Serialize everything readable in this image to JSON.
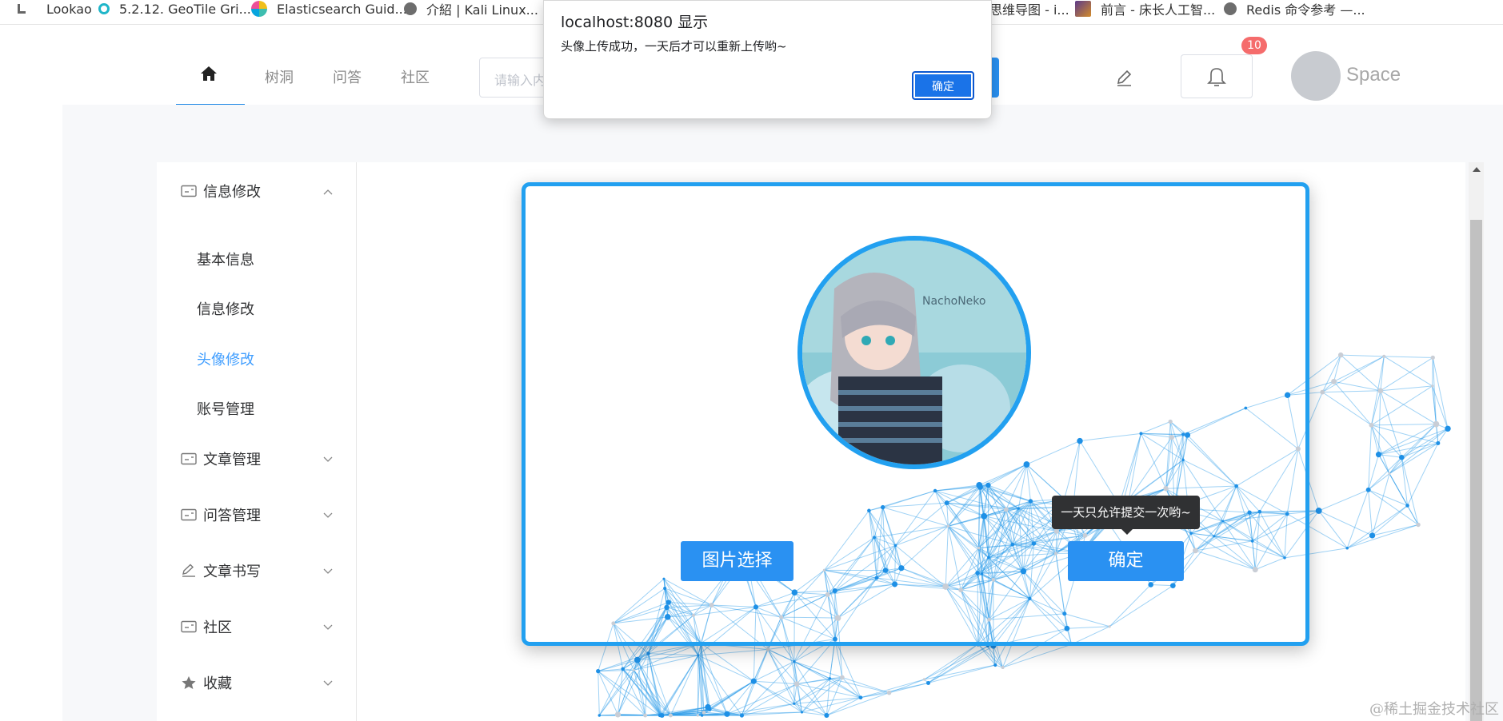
{
  "bookmarks": [
    {
      "label": "Lookao",
      "icon": "bookmark-l-icon"
    },
    {
      "label": "5.2.12. GeoTile Gri...",
      "icon": "geotile-icon"
    },
    {
      "label": "Elasticsearch Guid...",
      "icon": "elastic-icon"
    },
    {
      "label": "介紹 | Kali Linux...",
      "icon": "globe-icon"
    },
    {
      "label": "思维导图 - i...",
      "icon": "mindmap-icon"
    },
    {
      "label": "前言 - 床长人工智...",
      "icon": "ai-icon"
    },
    {
      "label": "Redis 命令参考 —...",
      "icon": "globe-icon"
    }
  ],
  "header": {
    "nav": [
      "树洞",
      "问答",
      "社区"
    ],
    "search_placeholder": "请输入内",
    "notification_count": "10",
    "username": "Space"
  },
  "sidebar": {
    "menus": [
      {
        "label": "信息修改",
        "icon": "card-icon",
        "expanded": true
      },
      {
        "label": "文章管理",
        "icon": "card-icon"
      },
      {
        "label": "问答管理",
        "icon": "card-icon"
      },
      {
        "label": "文章书写",
        "icon": "pen-icon"
      },
      {
        "label": "社区",
        "icon": "card-icon"
      },
      {
        "label": "收藏",
        "icon": "star-icon"
      }
    ],
    "submenu": [
      "基本信息",
      "信息修改",
      "头像修改",
      "账号管理"
    ],
    "active_submenu": "头像修改"
  },
  "upload_card": {
    "choose_label": "图片选择",
    "confirm_label": "确定",
    "tooltip": "一天只允许提交一次哟~",
    "avatar_caption": "NachoNeko"
  },
  "alert": {
    "title": "localhost:8080 显示",
    "message": "头像上传成功，一天后才可以重新上传哟~",
    "ok_label": "确定"
  },
  "watermark": "@稀土掘金技术社区",
  "colors": {
    "accent": "#2a91f2",
    "card_border": "#22a0f0",
    "badge": "#f56c6c",
    "active_menu": "#409eff"
  }
}
